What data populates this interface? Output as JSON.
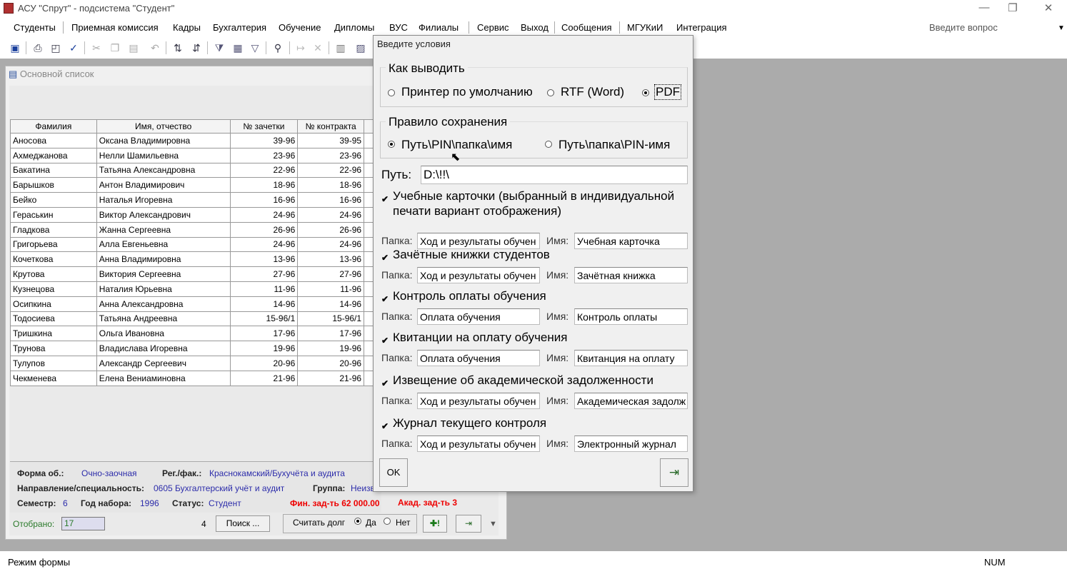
{
  "window": {
    "title": "АСУ \"Спрут\" - подсистема \"Студент\"",
    "controls": [
      "—",
      "❐",
      "✕"
    ]
  },
  "menu": {
    "items": [
      "Студенты",
      "Приемная комиссия",
      "Кадры",
      "Бухгалтерия",
      "Обучение",
      "Дипломы",
      "ВУС",
      "Филиалы",
      "Сервис",
      "Выход",
      "Сообщения",
      "МГУКиИ",
      "Интеграция"
    ],
    "help_placeholder": "Введите вопрос"
  },
  "toolbar": {
    "icons": [
      "save-icon",
      "print-icon",
      "print-preview-icon",
      "spellcheck-icon",
      "cut-icon",
      "copy-icon",
      "paste-icon",
      "undo-icon",
      "sort-asc-icon",
      "sort-desc-icon",
      "filter-selection-icon",
      "filter-form-icon",
      "apply-filter-icon",
      "find-icon",
      "go-to-icon",
      "delete-icon",
      "database-window-icon",
      "new-object-icon"
    ]
  },
  "main_form": {
    "title": "Основной список",
    "columns": [
      "Фамилия",
      "Имя, отчество",
      "№ зачетки",
      "№ контракта"
    ],
    "rows": [
      [
        "Аносова",
        "Оксана Владимировна",
        "39-96",
        "39-95"
      ],
      [
        "Ахмеджанова",
        "Нелли Шамильевна",
        "23-96",
        "23-96"
      ],
      [
        "Бакатина",
        "Татьяна Александровна",
        "22-96",
        "22-96"
      ],
      [
        "Барышков",
        "Антон Владимирович",
        "18-96",
        "18-96"
      ],
      [
        "Бейко",
        "Наталья Игоревна",
        "16-96",
        "16-96"
      ],
      [
        "Гераськин",
        "Виктор Александрович",
        "24-96",
        "24-96"
      ],
      [
        "Гладкова",
        "Жанна Сергеевна",
        "26-96",
        "26-96"
      ],
      [
        "Григорьева",
        "Алла Евгеньевна",
        "24-96",
        "24-96"
      ],
      [
        "Кочеткова",
        "Анна Владимировна",
        "13-96",
        "13-96"
      ],
      [
        "Крутова",
        "Виктория Сергеевна",
        "27-96",
        "27-96"
      ],
      [
        "Кузнецова",
        "Наталия Юрьевна",
        "11-96",
        "11-96"
      ],
      [
        "Осипкина",
        "Анна Александровна",
        "14-96",
        "14-96"
      ],
      [
        "Тодосиева",
        "Татьяна Андреевна",
        "15-96/1",
        "15-96/1"
      ],
      [
        "Тришкина",
        "Ольга Ивановна",
        "17-96",
        "17-96"
      ],
      [
        "Трунова",
        "Владислава Игоревна",
        "19-96",
        "19-96"
      ],
      [
        "Тулупов",
        "Александр Сергеевич",
        "20-96",
        "20-96"
      ],
      [
        "Чекменева",
        "Елена Вениаминовна",
        "21-96",
        "21-96"
      ]
    ],
    "info": {
      "forma_label": "Форма об.:",
      "forma_value": "Очно-заочная",
      "reg_label": "Рег./фак.:",
      "reg_value": "Краснокамский/Бухучёта и аудита",
      "napr_label": "Направление/специальность:",
      "napr_value": "0605 Бухгалтерский учёт и аудит",
      "group_label": "Группа:",
      "group_value": "Неизв",
      "sem_label": "Семестр:",
      "sem_value": "6",
      "year_label": "Год набора:",
      "year_value": "1996",
      "status_label": "Статус:",
      "status_value": "Студент",
      "fin_debt": "Фин. зад-ть  62 000.00",
      "acad_debt": "Акад. зад-ть  3"
    },
    "bottom": {
      "selected_label": "Отобрано:",
      "selected_value": "17",
      "count": "4",
      "search_label": "Поиск ...",
      "debt_label": "Считать долг",
      "yes": "Да",
      "no": "Нет"
    }
  },
  "dialog": {
    "title": "Введите условия",
    "output_group": "Как выводить",
    "output_options": [
      "Принтер по умолчанию",
      "RTF (Word)",
      "PDF"
    ],
    "output_selected": 2,
    "save_group": "Правило сохранения",
    "save_options": [
      "Путь\\PIN\\папка\\имя",
      "Путь\\папка\\PIN-имя"
    ],
    "save_selected": 0,
    "path_label": "Путь:",
    "path_value": "D:\\!!\\",
    "folder_label": "Папка:",
    "name_label": "Имя:",
    "items": [
      {
        "label": "Учебные карточки (выбранный в индивидуальной",
        "label2": "печати вариант отображения)",
        "checked": true,
        "folder": "Ход и результаты обучен",
        "name": "Учебная карточка"
      },
      {
        "label": "Зачётные книжки студентов",
        "checked": true,
        "folder": "Ход и результаты обучен",
        "name": "Зачётная книжка"
      },
      {
        "label": "Контроль оплаты обучения",
        "checked": true,
        "folder": "Оплата обучения",
        "name": "Контроль оплаты"
      },
      {
        "label": "Квитанции на оплату обучения",
        "checked": true,
        "folder": "Оплата обучения",
        "name": "Квитанция на оплату"
      },
      {
        "label": "Извещение об академической задолженности",
        "checked": true,
        "folder": "Ход и результаты обучен",
        "name": "Академическая задолж"
      },
      {
        "label": "Журнал текущего контроля",
        "checked": true,
        "folder": "Ход и результаты обучен",
        "name": "Электронный журнал"
      }
    ],
    "ok_label": "OK"
  },
  "statusbar": {
    "left": "Режим формы",
    "right": "NUM"
  }
}
